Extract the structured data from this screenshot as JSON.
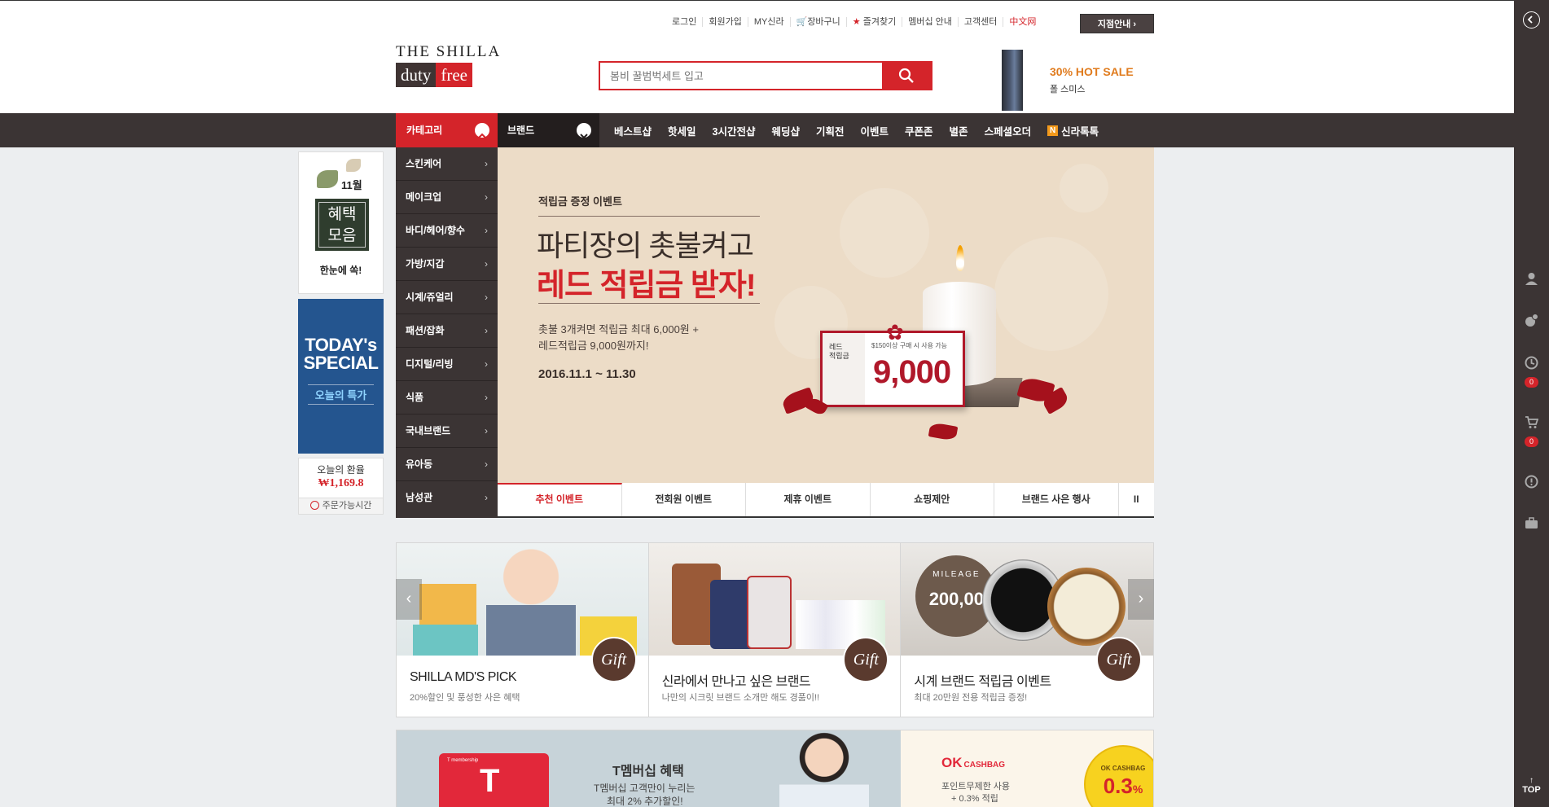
{
  "util_links": [
    "로그인",
    "회원가입",
    "MY신라",
    "장바구니",
    "즐겨찾기",
    "멤버십 안내",
    "고객센터",
    "中文网"
  ],
  "store_button": "지점안내",
  "logo": {
    "line1": "THE SHILLA",
    "duty": "duty",
    "free": "free"
  },
  "search": {
    "placeholder": "봄비 꿀범벅세트 입고"
  },
  "hot_sale": {
    "title": "30% HOT SALE",
    "subtitle": "폴 스미스"
  },
  "gnb": {
    "category": "카테고리",
    "brand": "브랜드",
    "menu": [
      "베스트샵",
      "핫세일",
      "3시간전샵",
      "웨딩샵",
      "기획전",
      "이벤트",
      "쿠폰존",
      "별존",
      "스페셜오더",
      "신라톡톡"
    ],
    "menu_badge": "N"
  },
  "categories": [
    "스킨케어",
    "메이크업",
    "바디/헤어/향수",
    "가방/지갑",
    "시계/쥬얼리",
    "패션/잡화",
    "디지털/리빙",
    "식품",
    "국내브랜드",
    "유아동",
    "남성관"
  ],
  "hero": {
    "sub": "적립금 증정 이벤트",
    "title1": "파티장의 촛불켜고",
    "title2": "레드 적립금 받자!",
    "desc1": "촛불 3개켜면 적립금 최대 6,000원 +",
    "desc2": "레드적립금 9,000원까지!",
    "date": "2016.11.1 ~ 11.30",
    "card_label1": "레드",
    "card_label2": "적립금",
    "card_small": "$150이상 구매 시 사용 가능",
    "card_value": "9,000"
  },
  "hero_tabs": [
    "추천 이벤트",
    "전회원 이벤트",
    "제휴 이벤트",
    "쇼핑제안",
    "브랜드 사은 행사"
  ],
  "hero_pause": "II",
  "left_banners": {
    "month": "11월",
    "benefit": "혜택\n모음",
    "benefit_line1": "혜택",
    "benefit_line2": "모음",
    "benefit_caption": "한눈에 쏙!",
    "today_line1": "TODAY's",
    "today_line2": "SPECIAL",
    "today_sub": "오늘의 특가",
    "rate_label": "오늘의 환율",
    "rate_value": "₩1,169.8",
    "order_time": "주문가능시간"
  },
  "events": [
    {
      "title": "SHILLA MD'S PICK",
      "sub": "20%할인 및 풍성한 사은 혜택",
      "gift": "Gift"
    },
    {
      "title": "신라에서 만나고 싶은 브랜드",
      "sub": "나만의 시크릿 브랜드 소개만 해도 경품이!!",
      "gift": "Gift"
    },
    {
      "title": "시계 브랜드 적립금 이벤트",
      "sub": "최대 20만원 전용 적립금 증정!",
      "gift": "Gift"
    }
  ],
  "mileage_badge": {
    "label": "MILEAGE",
    "value": "200,00"
  },
  "promo": {
    "t_title": "T멤버십 혜택",
    "t_desc1": "T멤버십 고객만이 누리는",
    "t_desc2": "최대 2% 추가할인!",
    "t_card_label": "T membership",
    "ok_logo": "OK",
    "ok_logo2": "CASHBAG",
    "ok_desc1": "포인트무제한 사용",
    "ok_desc2": "+ 0.3% 적립",
    "ok_badge": "OK CASHBAG",
    "ok_pct": "0.3"
  },
  "right_sidebar": {
    "recent_count": "0",
    "cart_count": "0",
    "top_label": "TOP"
  },
  "colors": {
    "brand_red": "#d4242a",
    "dark_brown": "#3b3434",
    "hot_orange": "#e07b1d"
  }
}
